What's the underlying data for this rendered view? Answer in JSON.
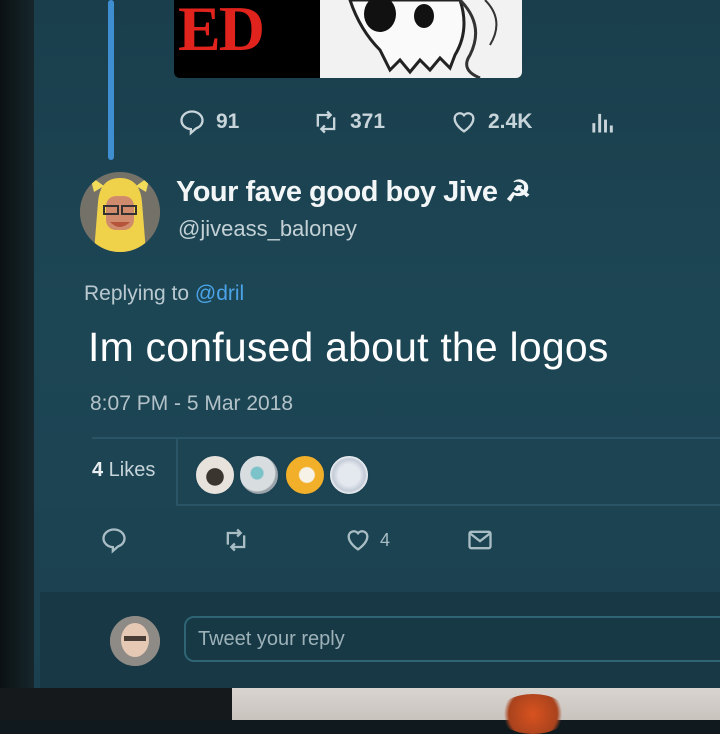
{
  "parent_tweet": {
    "media_partial_text": "ED",
    "stats": {
      "replies": "91",
      "retweets": "371",
      "likes": "2.4K"
    }
  },
  "tweet": {
    "display_name": "Your fave good boy Jive ☭",
    "handle": "@jiveass_baloney",
    "replying_prefix": "Replying to ",
    "replying_to": "@dril",
    "text": "Im confused about the logos",
    "timestamp": "8:07 PM - 5 Mar 2018",
    "likes_count": "4",
    "likes_label": " Likes",
    "action_like_count": "4"
  },
  "reply_box": {
    "placeholder": "Tweet your reply"
  },
  "colors": {
    "background": "#1b4150",
    "accent": "#3e8ed1",
    "mention": "#4aa3e6",
    "text": "#ffffff",
    "muted": "#b2c2c8"
  },
  "icons": {
    "reply": "reply-icon",
    "retweet": "retweet-icon",
    "like": "heart-icon",
    "analytics": "analytics-icon",
    "message": "envelope-icon"
  }
}
